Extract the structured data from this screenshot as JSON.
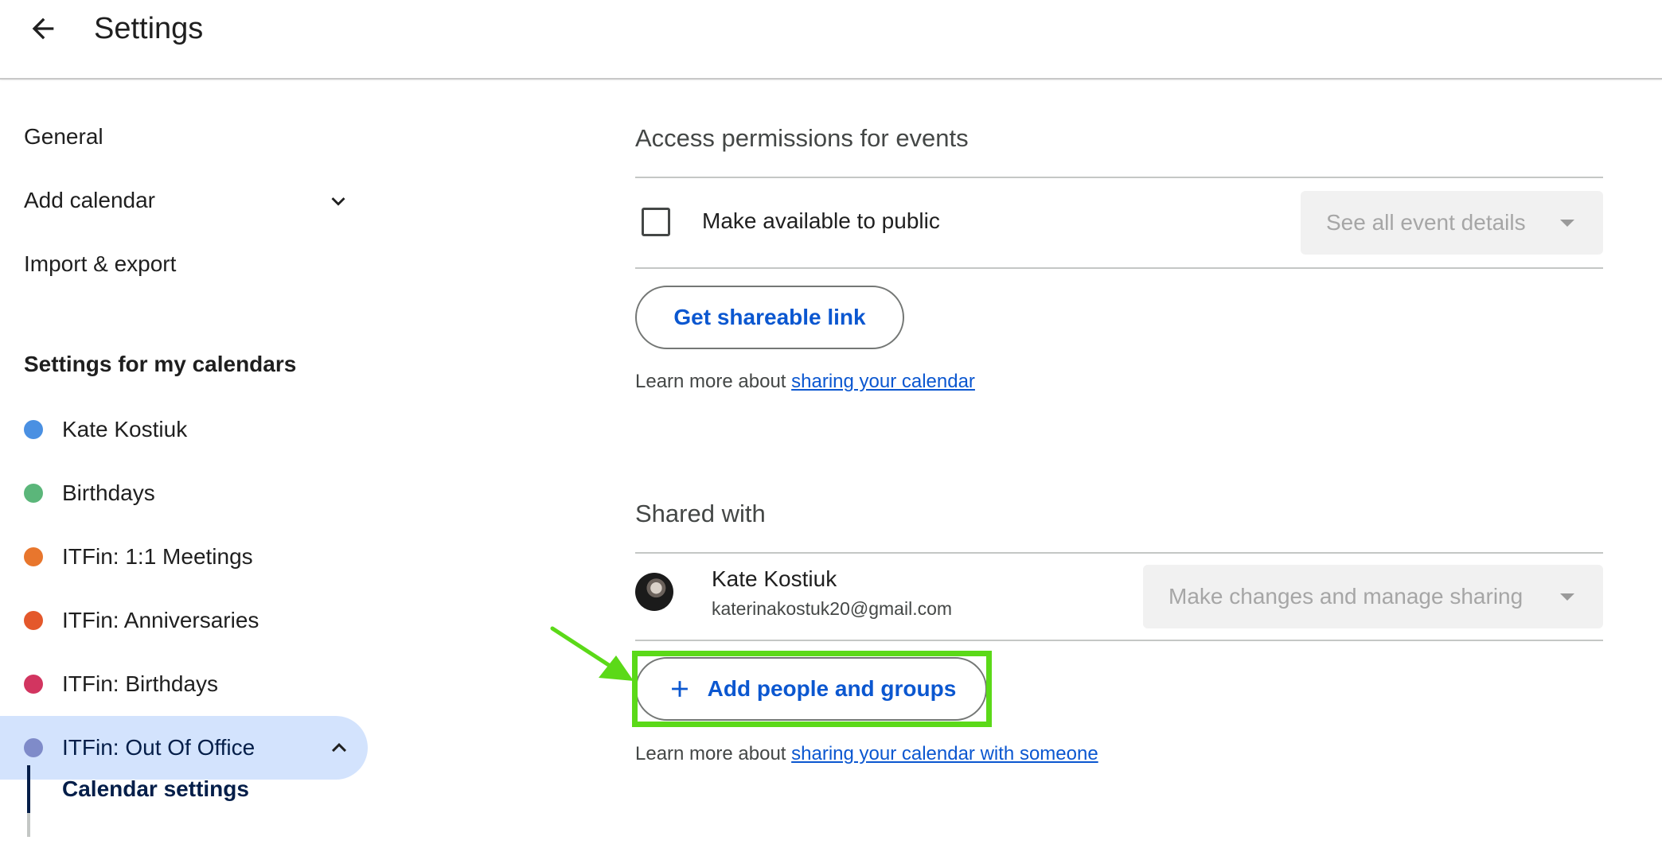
{
  "header": {
    "title": "Settings",
    "back_icon": "arrow-back-icon"
  },
  "sidebar": {
    "general_label": "General",
    "add_calendar_label": "Add calendar",
    "import_export_label": "Import & export",
    "my_calendars_heading": "Settings for my calendars",
    "calendars": [
      {
        "label": "Kate Kostiuk",
        "color": "#4a90e2"
      },
      {
        "label": "Birthdays",
        "color": "#5bb67a"
      },
      {
        "label": "ITFin: 1:1 Meetings",
        "color": "#e8762d"
      },
      {
        "label": "ITFin: Anniversaries",
        "color": "#e4582b"
      },
      {
        "label": "ITFin: Birthdays",
        "color": "#d23560"
      },
      {
        "label": "ITFin: Out Of Office",
        "color": "#7f8bc9"
      }
    ],
    "sub_item_label": "Calendar settings"
  },
  "access": {
    "heading": "Access permissions for events",
    "public_label": "Make available to public",
    "public_checked": false,
    "detail_select": "See all event details",
    "share_link_button": "Get shareable link",
    "learn_prefix": "Learn more about ",
    "learn_link": "sharing your calendar"
  },
  "shared": {
    "heading": "Shared with",
    "person_name": "Kate Kostiuk",
    "person_email": "katerinakostuk20@gmail.com",
    "permission_select": "Make changes and manage sharing",
    "add_button": "Add people and groups",
    "learn_prefix": "Learn more about ",
    "learn_link": "sharing your calendar with someone"
  },
  "annotation": {
    "highlight_color": "#5bd918"
  }
}
